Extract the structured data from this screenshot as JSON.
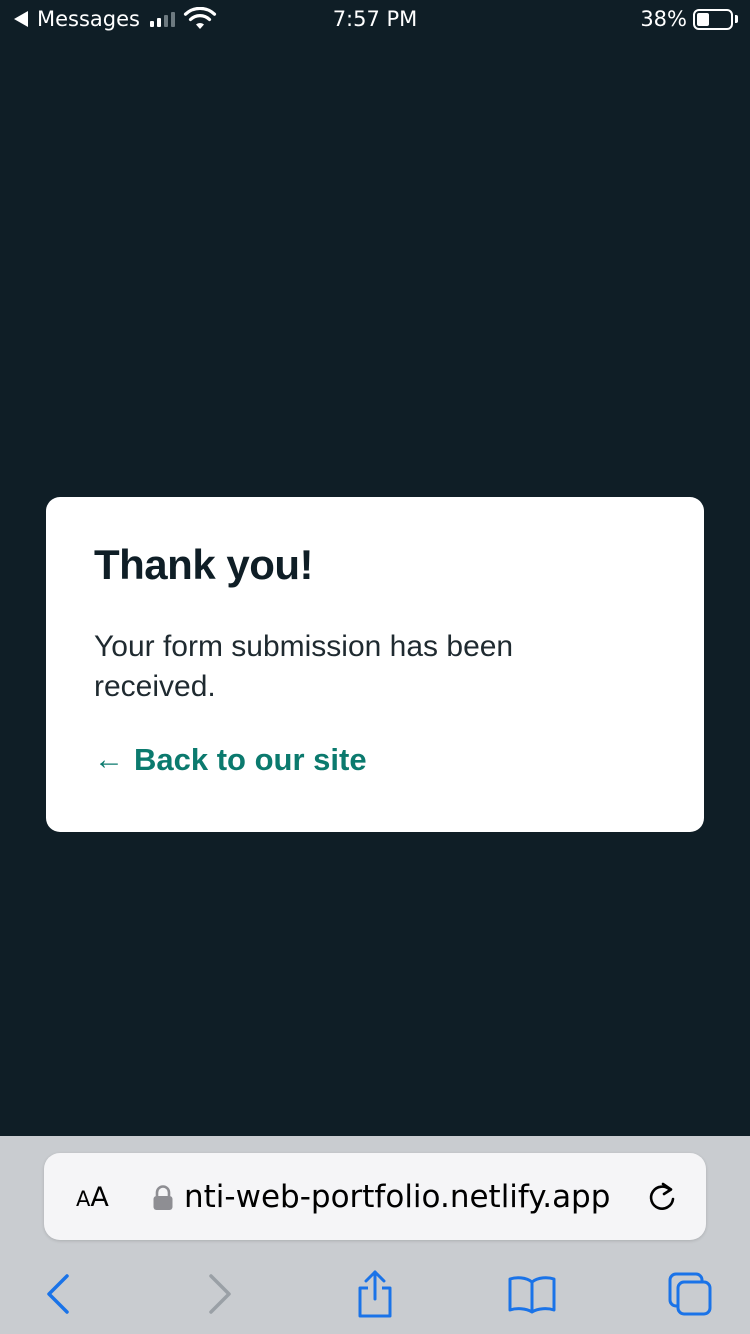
{
  "status_bar": {
    "back_label": "Messages",
    "time": "7:57 PM",
    "battery_percent": "38%",
    "battery_level": 0.38,
    "signal_bars_active": 2,
    "signal_bars_total": 4
  },
  "card": {
    "title": "Thank you!",
    "message": "Your form submission has been received.",
    "back_arrow": "←",
    "back_link_label": "Back to our site"
  },
  "browser": {
    "text_size_small": "A",
    "text_size_big": "A",
    "url": "nti-web-portfolio.netlify.app",
    "icons": [
      "lock-icon",
      "reload-icon",
      "back-icon",
      "forward-icon",
      "share-icon",
      "bookmarks-icon",
      "tabs-icon"
    ]
  },
  "colors": {
    "page_background": "#0f1e26",
    "card_background": "#ffffff",
    "link_accent": "#0b7a6e",
    "toolbar_blue": "#1a73e8",
    "toolbar_disabled": "#9aa0a6",
    "chrome_background": "#c9ccd0"
  }
}
